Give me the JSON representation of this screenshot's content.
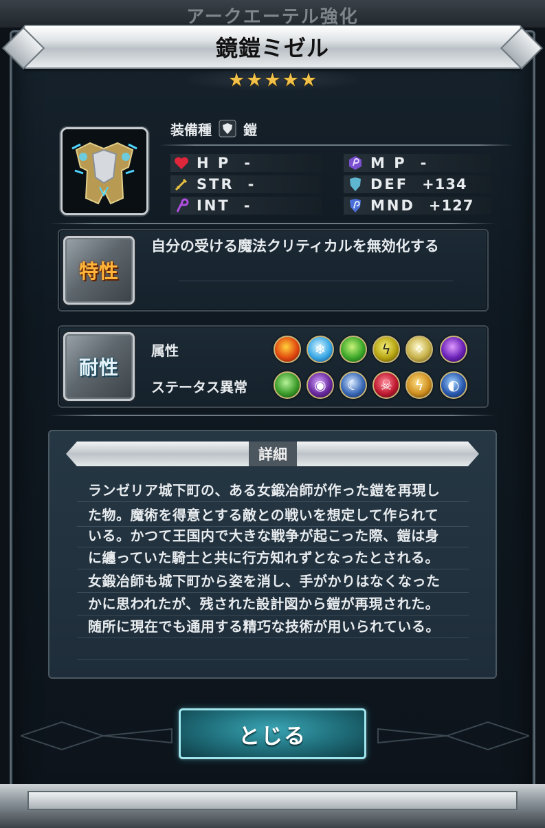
{
  "background_title": "アークエーテル強化",
  "item": {
    "name": "鏡鎧ミゼル",
    "rarity_stars": 5,
    "star_glyph": "★",
    "equip_type_label": "装備種",
    "equip_type_value": "鎧"
  },
  "stats": {
    "hp": {
      "label": "H P",
      "value": "-"
    },
    "mp": {
      "label": "M P",
      "value": "-"
    },
    "str": {
      "label": "STR",
      "value": "-"
    },
    "def": {
      "label": "DEF",
      "value": "+134"
    },
    "int": {
      "label": "INT",
      "value": "-"
    },
    "mnd": {
      "label": "MND",
      "value": "+127"
    }
  },
  "trait": {
    "badge": "特性",
    "text": "自分の受ける魔法クリティカルを無効化する"
  },
  "resistance": {
    "badge": "耐性",
    "element_label": "属性",
    "elements": [
      "fire-icon",
      "ice-icon",
      "wind-icon",
      "earth-icon",
      "light-icon",
      "dark-icon"
    ],
    "status_label": "ステータス異常",
    "statuses": [
      "poison-icon",
      "blind-icon",
      "sleep-icon",
      "death-icon",
      "paralysis-icon",
      "confuse-icon"
    ]
  },
  "detail": {
    "header": "詳細",
    "lines": [
      "ランゼリア城下町の、ある女鍛冶師が作った鎧を再現し",
      "た物。魔術を得意とする敵との戦いを想定して作られて",
      "いる。かつて王国内で大きな戦争が起こった際、鎧は身",
      "に纏っていた騎士と共に行方知れずとなったとされる。",
      "女鍛冶師も城下町から姿を消し、手がかりはなくなった",
      "かに思われたが、残された設計図から鎧が再現された。",
      "随所に現在でも通用する精巧な技術が用いられている。"
    ]
  },
  "close_button": "とじる",
  "colors": {
    "accent": "#3aa4b3",
    "star": "#f2c14a",
    "hp": "#e0263a",
    "str": "#e8c040",
    "int": "#b04ee0",
    "mp": "#7a4fd0",
    "def": "#5fb6d0",
    "mnd": "#4a6fd8"
  }
}
